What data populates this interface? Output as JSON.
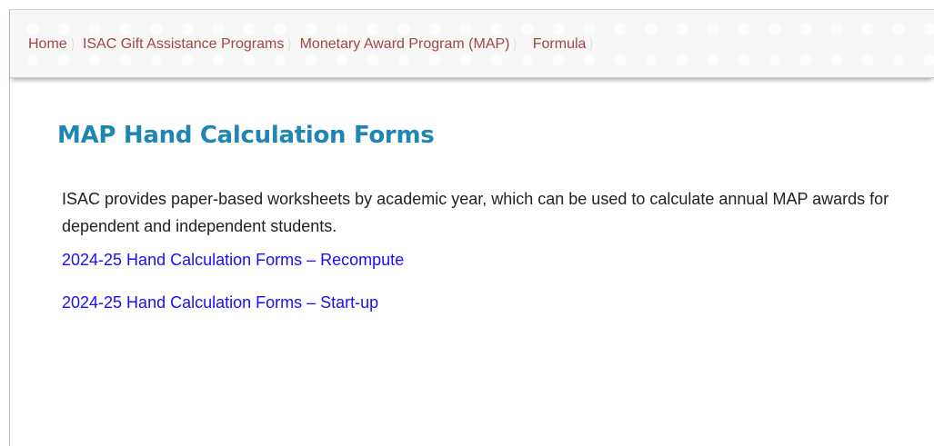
{
  "breadcrumb": {
    "items": [
      {
        "label": "Home"
      },
      {
        "label": "ISAC Gift Assistance Programs"
      },
      {
        "label": "Monetary Award Program (MAP)"
      },
      {
        "label": "Formula"
      }
    ],
    "separator": "⟩"
  },
  "main": {
    "title": "MAP Hand Calculation Forms",
    "intro": "ISAC provides paper-based worksheets by academic year, which can be used to calculate annual MAP awards for dependent and independent students.",
    "links": [
      {
        "label": "2024-25 Hand Calculation Forms – Recompute"
      },
      {
        "label": "2024-25 Hand Calculation Forms – Start-up"
      }
    ]
  },
  "colors": {
    "breadcrumb_text": "#a0473f",
    "title": "#1e86b5",
    "link": "#1a0dff",
    "body_text": "#222222"
  }
}
